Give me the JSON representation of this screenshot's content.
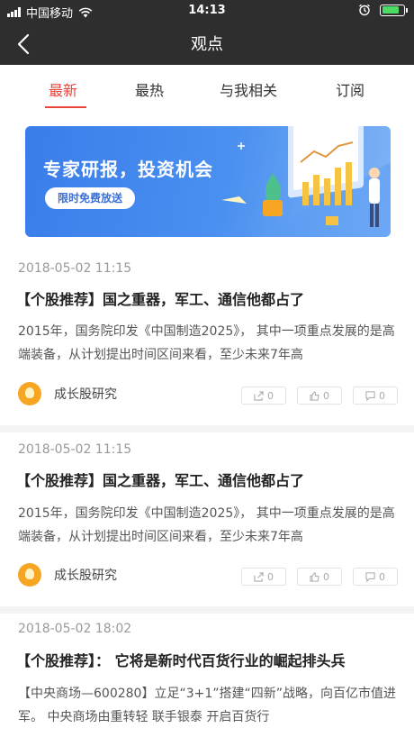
{
  "status_bar": {
    "carrier": "中国移动",
    "time": "14:13"
  },
  "header": {
    "title": "观点",
    "back_icon": "chevron-left-icon"
  },
  "tabs": [
    {
      "label": "最新",
      "active": true
    },
    {
      "label": "最热",
      "active": false
    },
    {
      "label": "与我相关",
      "active": false
    },
    {
      "label": "订阅",
      "active": false
    }
  ],
  "banner": {
    "title": "专家研报，投资机会",
    "pill": "限时免费放送"
  },
  "articles": [
    {
      "date": "2018-05-02 11:15",
      "title": "【个股推荐】国之重器，军工、通信他都占了",
      "body": "2015年，国务院印发《中国制造2025》， 其中一项重点发展的是高端装备，从计划提出时间区间来看，至少未来7年高",
      "author": "成长股研究",
      "shares": "0",
      "likes": "0",
      "comments": "0"
    },
    {
      "date": "2018-05-02 11:15",
      "title": "【个股推荐】国之重器，军工、通信他都占了",
      "body": "2015年，国务院印发《中国制造2025》， 其中一项重点发展的是高端装备，从计划提出时间区间来看，至少未来7年高",
      "author": "成长股研究",
      "shares": "0",
      "likes": "0",
      "comments": "0"
    },
    {
      "date": "2018-05-02 18:02",
      "title": "【个股推荐】： 它将是新时代百货行业的崛起排头兵",
      "body": "【中央商场—600280】立足“3+1”搭建“四新”战略，向百亿市值进军。 中央商场由重转轻 联手银泰 开启百货行"
    }
  ],
  "colors": {
    "accent": "#e8453c",
    "header_bg": "#2e2e2e",
    "banner": "#3a7dea",
    "avatar": "#f6a623"
  }
}
